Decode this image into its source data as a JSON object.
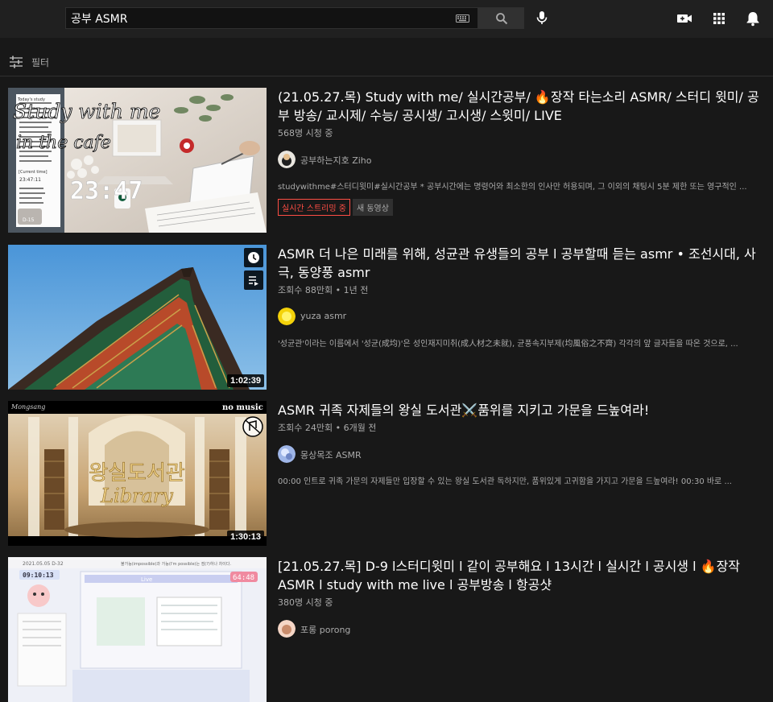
{
  "search": {
    "query": "공부 ASMR"
  },
  "filter": {
    "label": "필터"
  },
  "colors": {
    "accent_live": "#ff4e45",
    "background": "#181818",
    "topbar": "#202020"
  },
  "results": [
    {
      "title": "(21.05.27.목) Study with me/ 실시간공부/ 🔥장작 타는소리 ASMR/ 스터디 윗미/ 공부 방송/ 교시제/ 수능/ 공시생/ 고시생/ 스윗미/ LIVE",
      "meta": "568명 시청 중",
      "channel": "공부하는지호 Ziho",
      "description": "studywithme#스터디윗미#실시간공부 * 공부시간에는 명령어와 최소한의 인사만 허용되며, 그 이외의 채팅시 5분 제한 또는 영구적인 ...",
      "badges": {
        "live": "실시간 스트리밍 중",
        "new": "새 동영상"
      },
      "thumb_text": {
        "line1": "Study with me",
        "line2": "in the cafe",
        "clock": "23:47",
        "today": "Today's study",
        "current": "[Current time]",
        "time": "23:47:11",
        "d": "D-15"
      }
    },
    {
      "title": "ASMR 더 나은 미래를 위해, 성균관 유생들의 공부 l 공부할때 듣는 asmr • 조선시대, 사극, 동양풍 asmr",
      "meta": "조회수 88만회 • 1년 전",
      "channel": "yuza asmr",
      "description": "'성균관'이라는 이름에서 '성균(成均)'은 성인재지미취(成人材之未就), 균풍속지부제(均風俗之不齊) 각각의 앞 글자들을 따온 것으로, ...",
      "duration": "1:02:39"
    },
    {
      "title": "ASMR 귀족 자제들의 왕실 도서관⚔️품위를 지키고 가문을 드높여라!",
      "meta": "조회수 24만회 • 6개월 전",
      "channel": "몽상목조 ASMR",
      "description": "00:00 인트로 귀족 가문의 자제들만 입장할 수 있는 왕실 도서관 독하지만, 품위있게 고귀함을 가지고 가문을 드높여라! 00:30 바로 ...",
      "duration": "1:30:13",
      "thumb_text": {
        "top_left": "Mongsang",
        "top_right": "no music",
        "title_kr": "왕실도서관",
        "title_en": "Library"
      }
    },
    {
      "title": "[21.05.27.목] D-9 l스터디윗미 l 같이 공부해요 l 13시간 l 실시간 l 공시생 l 🔥장작ASMR l study with me live l 공부방송 l 항공샷",
      "meta": "380명 시청 중",
      "channel": "포롱 porong",
      "thumb_text": {
        "date": "2021.05.05  D-32",
        "clock": "09:10:13",
        "live": "Live",
        "timer": "64:48",
        "caption": "불가능(impossible)과 가능(I'm possible)는 점(?)하나 차이다."
      }
    }
  ]
}
